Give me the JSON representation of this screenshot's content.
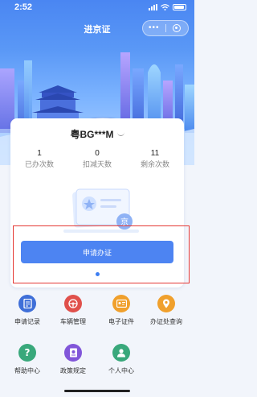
{
  "status_bar": {
    "time": "2:52"
  },
  "nav": {
    "title": "进京证",
    "menu_icon": "more-dots-icon",
    "close_icon": "target-icon"
  },
  "vehicle": {
    "plate": "粤BG***M"
  },
  "stats": [
    {
      "value": "1",
      "label": "已办次数"
    },
    {
      "value": "0",
      "label": "扣减天数"
    },
    {
      "value": "11",
      "label": "剩余次数"
    }
  ],
  "illustration": {
    "badge_text": "京"
  },
  "apply_button": {
    "label": "申请办证"
  },
  "colors": {
    "primary": "#4d84f2",
    "highlight_border": "#e53935"
  },
  "services": [
    {
      "label": "申请记录",
      "icon": "document-icon",
      "color": "#3f6fd8"
    },
    {
      "label": "车辆管理",
      "icon": "steering-wheel-icon",
      "color": "#e0504b"
    },
    {
      "label": "电子证件",
      "icon": "id-card-icon",
      "color": "#f0a02c"
    },
    {
      "label": "办证处查询",
      "icon": "location-pin-icon",
      "color": "#f0a02c"
    },
    {
      "label": "帮助中心",
      "icon": "help-icon",
      "color": "#39a87b"
    },
    {
      "label": "政策规定",
      "icon": "policy-icon",
      "color": "#8156d9"
    },
    {
      "label": "个人中心",
      "icon": "user-icon",
      "color": "#39a87b"
    }
  ]
}
